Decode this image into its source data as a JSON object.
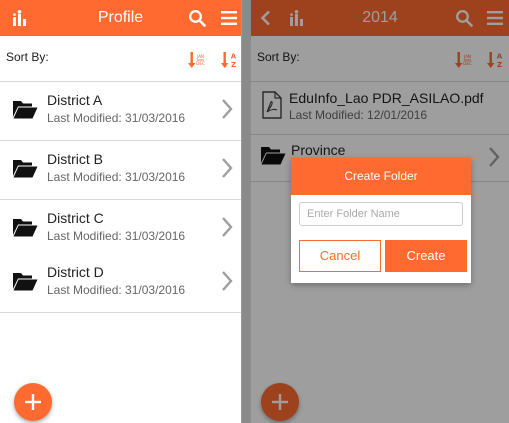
{
  "colors": {
    "accent": "#ff6a30",
    "divider": "#d9d9d9",
    "chevron": "#9e9e9e"
  },
  "left": {
    "header": {
      "title": "Profile"
    },
    "sort_label": "Sort By:",
    "sort_date_badge": [
      "JAN",
      "DEC"
    ],
    "sort_alpha_badge": [
      "A",
      "Z"
    ],
    "items": [
      {
        "name": "District A",
        "modified": "Last Modified: 31/03/2016"
      },
      {
        "name": "District B",
        "modified": "Last Modified: 31/03/2016"
      },
      {
        "name": "District C",
        "modified": "Last Modified: 31/03/2016"
      },
      {
        "name": "District D",
        "modified": "Last Modified: 31/03/2016"
      }
    ]
  },
  "right": {
    "header": {
      "title": "2014"
    },
    "sort_label": "Sort By:",
    "sort_date_badge": [
      "JAN",
      "DEC"
    ],
    "sort_alpha_badge": [
      "A",
      "Z"
    ],
    "items": [
      {
        "name": "EduInfo_Lao PDR_ASILAO.pdf",
        "modified": "Last Modified: 12/01/2016"
      },
      {
        "name": "Province"
      }
    ],
    "dialog": {
      "title": "Create Folder",
      "input_placeholder": "Enter Folder Name",
      "cancel_label": "Cancel",
      "create_label": "Create"
    }
  }
}
